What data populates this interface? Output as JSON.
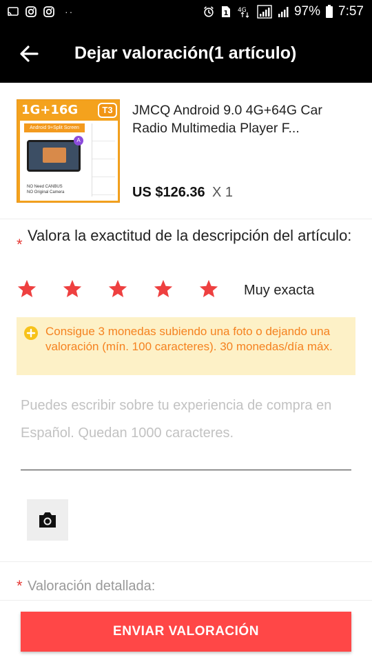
{
  "status_bar": {
    "left_icons": [
      "cast-icon",
      "instagram-icon",
      "instagram-icon"
    ],
    "dots": "··",
    "network": "4G",
    "battery": "97%",
    "time": "7:57"
  },
  "app_bar": {
    "back_icon": "arrow-left-icon",
    "title": "Dejar valoración(1 artículo)"
  },
  "product": {
    "thumbnail": {
      "spec": "1G+16G",
      "badge": "T3",
      "banner": "Android 9+Split Screen",
      "note_line1": "NO Need CANBUS",
      "note_line2": "NO Original Camera"
    },
    "title": "JMCQ Android 9.0 4G+64G Car Radio Multimedia Player F...",
    "price": "US $126.36",
    "quantity": "X 1"
  },
  "rating": {
    "required_mark": "*",
    "question": "Valora la exactitud de la descripción del artículo:",
    "stars_selected": 5,
    "stars_total": 5,
    "label": "Muy exacta",
    "star_color": "#ee4040"
  },
  "coin_banner": {
    "icon": "coin-plus-icon",
    "text": "Consigue 3 monedas subiendo una foto o dejando una valoración (mín. 100 caracteres). 30 monedas/día máx.",
    "text_color": "#f58220",
    "background": "#fdf1c7"
  },
  "review": {
    "value": "",
    "placeholder": "Puedes escribir sobre tu experiencia de compra en Español. Quedan 1000 caracteres."
  },
  "photo_button": {
    "icon": "camera-icon"
  },
  "detail": {
    "required_mark": "*",
    "label": "Valoración detallada:"
  },
  "submit": {
    "label": "ENVIAR VALORACIÓN",
    "color": "#ff4747"
  }
}
